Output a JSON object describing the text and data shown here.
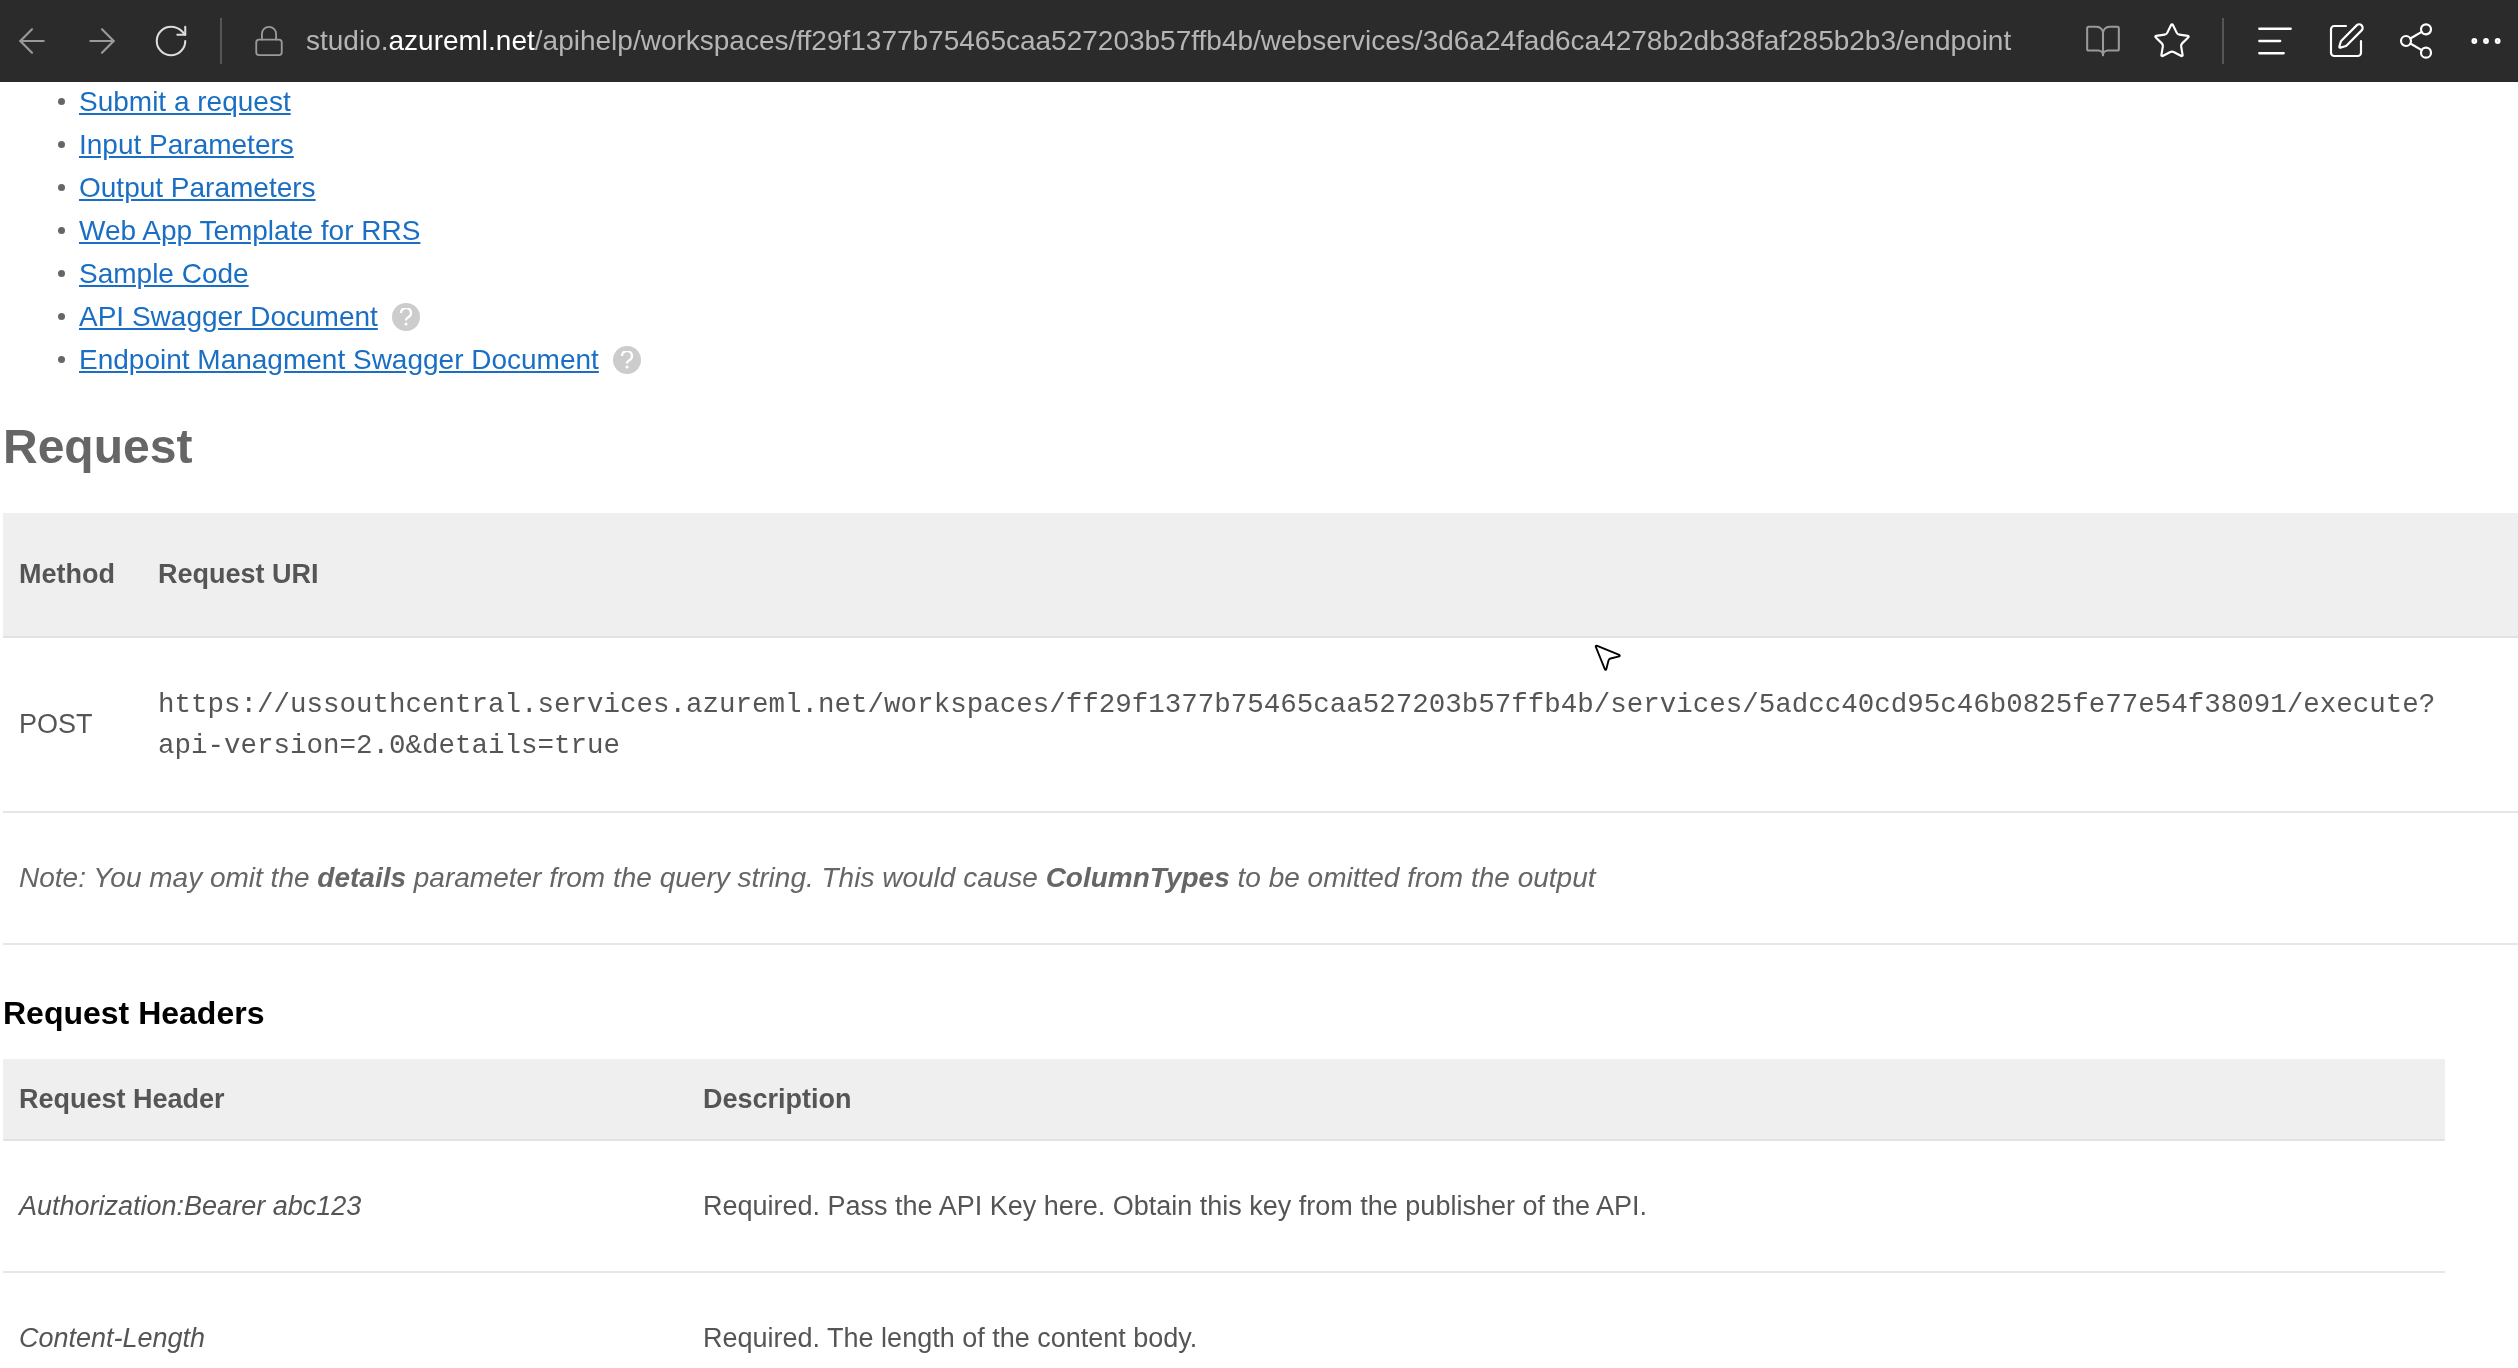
{
  "browser": {
    "url_prefix": "studio.",
    "url_domain": "azureml.net",
    "url_path": "/apihelp/workspaces/ff29f1377b75465caa527203b57ffb4b/webservices/3d6a24fad6ca4278b2db38faf285b2b3/endpoint"
  },
  "links": [
    {
      "label": "Submit a request",
      "help": false
    },
    {
      "label": "Input Parameters",
      "help": false
    },
    {
      "label": "Output Parameters",
      "help": false
    },
    {
      "label": "Web App Template for RRS",
      "help": false
    },
    {
      "label": "Sample Code",
      "help": false
    },
    {
      "label": "API Swagger Document",
      "help": true
    },
    {
      "label": "Endpoint Managment Swagger Document",
      "help": true
    }
  ],
  "request": {
    "title": "Request",
    "columns": [
      "Method",
      "Request URI"
    ],
    "rows": [
      {
        "method": "POST",
        "uri": "https://ussouthcentral.services.azureml.net/workspaces/ff29f1377b75465caa527203b57ffb4b/services/5adcc40cd95c46b0825fe77e54f38091/execute?api-version=2.0&details=true"
      }
    ],
    "note": "Note: You may omit the **details** parameter from the query string. This would cause **ColumnTypes** to be omitted from the output"
  },
  "request_headers": {
    "title": "Request Headers",
    "columns": [
      "Request Header",
      "Description"
    ],
    "rows": [
      {
        "header": "Authorization:Bearer abc123",
        "description": "Required. Pass the API Key here. Obtain this key from the publisher of the API."
      },
      {
        "header": "Content-Length",
        "description": "Required. The length of the content body."
      }
    ]
  }
}
